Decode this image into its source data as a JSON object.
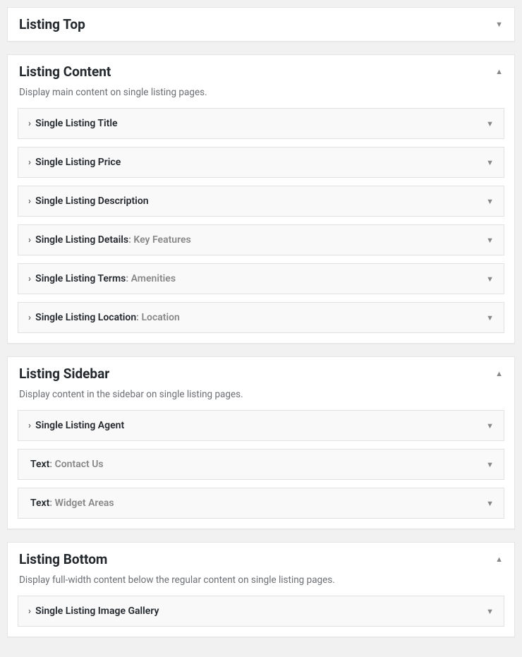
{
  "sections": [
    {
      "title": "Listing Top",
      "description": null,
      "expanded": false,
      "widgets": []
    },
    {
      "title": "Listing Content",
      "description": "Display main content on single listing pages.",
      "expanded": true,
      "widgets": [
        {
          "prefix": "› ",
          "label": "Single Listing Title",
          "suffix": ""
        },
        {
          "prefix": "› ",
          "label": "Single Listing Price",
          "suffix": ""
        },
        {
          "prefix": "› ",
          "label": "Single Listing Description",
          "suffix": ""
        },
        {
          "prefix": "› ",
          "label": "Single Listing Details",
          "suffix": ": Key Features"
        },
        {
          "prefix": "› ",
          "label": "Single Listing Terms",
          "suffix": ": Amenities"
        },
        {
          "prefix": "› ",
          "label": "Single Listing Location",
          "suffix": ": Location"
        }
      ]
    },
    {
      "title": "Listing Sidebar",
      "description": "Display content in the sidebar on single listing pages.",
      "expanded": true,
      "widgets": [
        {
          "prefix": "› ",
          "label": "Single Listing Agent",
          "suffix": ""
        },
        {
          "prefix": "",
          "label": "Text",
          "suffix": ": Contact Us"
        },
        {
          "prefix": "",
          "label": "Text",
          "suffix": ": Widget Areas"
        }
      ]
    },
    {
      "title": "Listing Bottom",
      "description": "Display full-width content below the regular content on single listing pages.",
      "expanded": true,
      "widgets": [
        {
          "prefix": "› ",
          "label": "Single Listing Image Gallery",
          "suffix": ""
        }
      ]
    }
  ]
}
